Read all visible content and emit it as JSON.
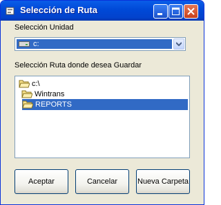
{
  "window": {
    "title": "Selección de Ruta"
  },
  "unidad": {
    "label": "Selección Unidad",
    "selected": "c:"
  },
  "ruta": {
    "label": "Selección Ruta donde desea Guardar",
    "items": [
      {
        "label": "c:\\",
        "state": "open"
      },
      {
        "label": "Wintrans",
        "state": "open"
      },
      {
        "label": "REPORTS",
        "state": "open",
        "selected": true
      }
    ]
  },
  "buttons": {
    "accept": "Aceptar",
    "cancel": "Cancelar",
    "new_folder": "Nueva Carpeta"
  }
}
